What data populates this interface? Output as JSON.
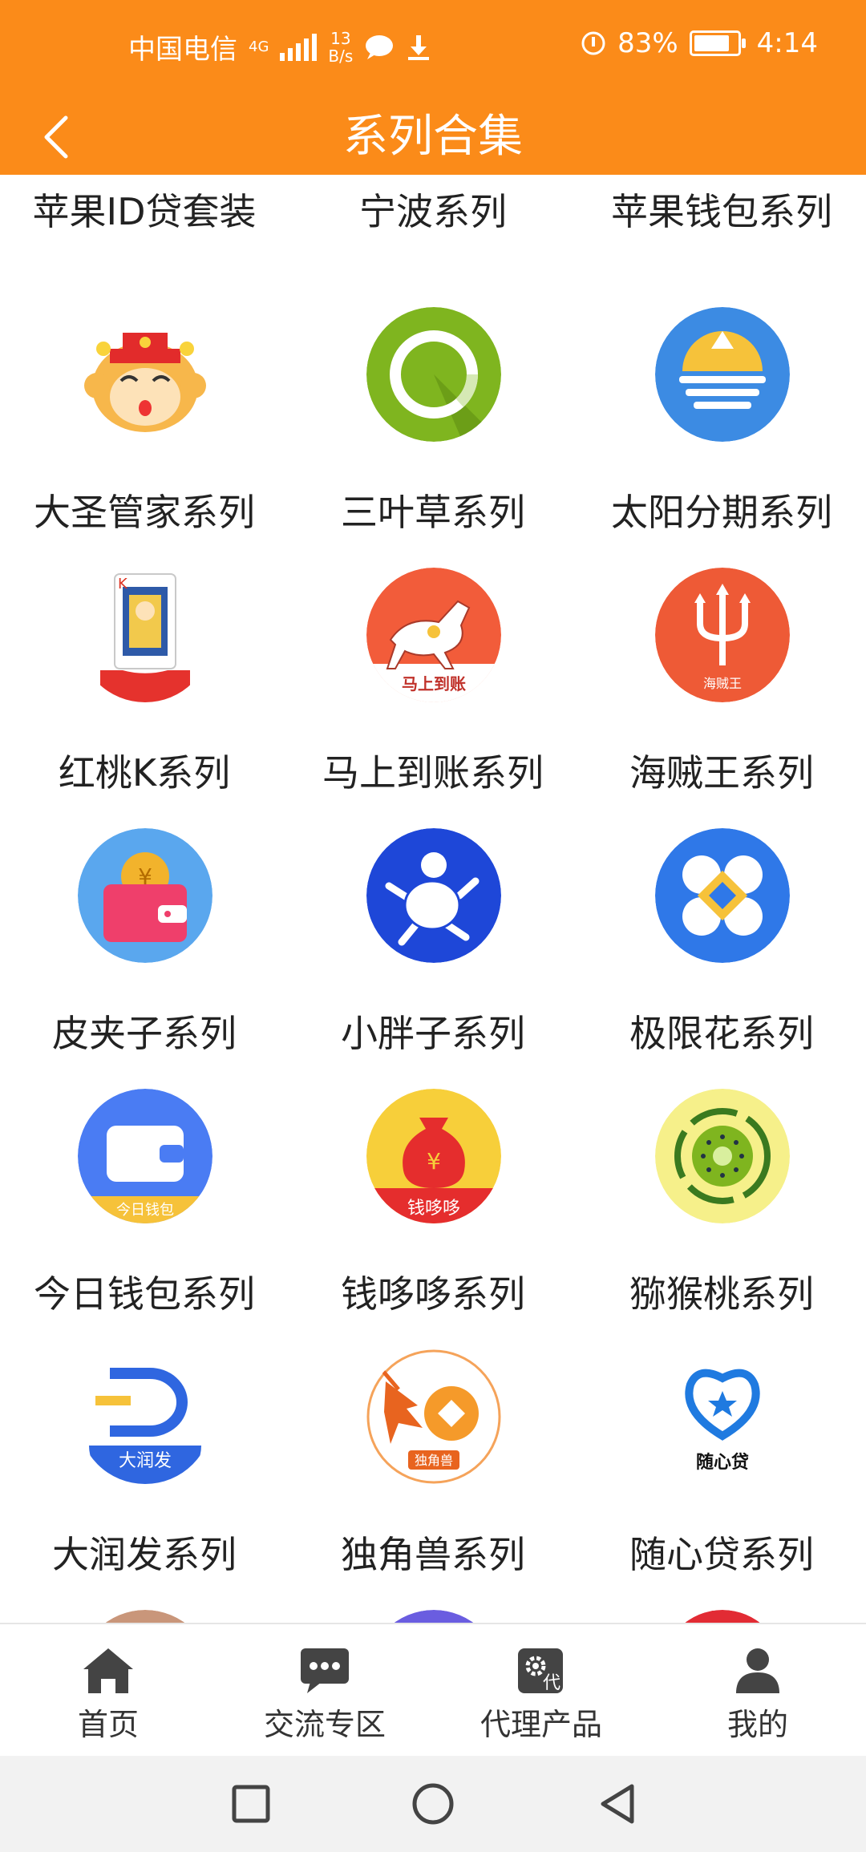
{
  "status_bar": {
    "carrier": "中国电信",
    "network": "4G",
    "speed_value": "13",
    "speed_unit": "B/s",
    "battery": "83%",
    "battery_level": 0.83,
    "time": "4:14"
  },
  "header": {
    "title": "系列合集"
  },
  "top_row_partial": [
    "苹果ID贷套装",
    "宁波系列",
    "苹果钱包系列"
  ],
  "series": [
    {
      "label": "大圣管家系列",
      "icon": "monkey-king-icon"
    },
    {
      "label": "三叶草系列",
      "icon": "green-ring-icon"
    },
    {
      "label": "太阳分期系列",
      "icon": "sun-waves-icon"
    },
    {
      "label": "红桃K系列",
      "icon": "king-of-hearts-card-icon"
    },
    {
      "label": "马上到账系列",
      "icon": "white-horse-icon",
      "icon_text": "马上到账"
    },
    {
      "label": "海贼王系列",
      "icon": "trident-icon",
      "icon_text": "海贼王"
    },
    {
      "label": "皮夹子系列",
      "icon": "wallet-coin-icon"
    },
    {
      "label": "小胖子系列",
      "icon": "running-man-icon"
    },
    {
      "label": "极限花系列",
      "icon": "flower-diamond-icon"
    },
    {
      "label": "今日钱包系列",
      "icon": "white-wallet-icon",
      "icon_text": "今日钱包"
    },
    {
      "label": "钱哆哆系列",
      "icon": "money-bag-icon",
      "icon_text": "钱哆哆"
    },
    {
      "label": "猕猴桃系列",
      "icon": "kiwi-icon"
    },
    {
      "label": "大润发系列",
      "icon": "letter-d-icon",
      "icon_text": "大润发"
    },
    {
      "label": "独角兽系列",
      "icon": "unicorn-icon",
      "icon_text": "独角兽"
    },
    {
      "label": "随心贷系列",
      "icon": "heart-star-icon",
      "icon_text": "随心贷"
    }
  ],
  "bottom_row_partial_icons": [
    "brown-circle-icon",
    "popcorn-icon",
    "red-diamond-icon"
  ],
  "tabbar": {
    "items": [
      {
        "label": "首页",
        "icon": "home-icon"
      },
      {
        "label": "交流专区",
        "icon": "chat-icon"
      },
      {
        "label": "代理产品",
        "icon": "agent-gear-icon",
        "badge": "代"
      },
      {
        "label": "我的",
        "icon": "user-icon"
      }
    ]
  },
  "colors": {
    "accent": "#fb8b19",
    "text": "#222222",
    "tab_icon": "#444444"
  }
}
